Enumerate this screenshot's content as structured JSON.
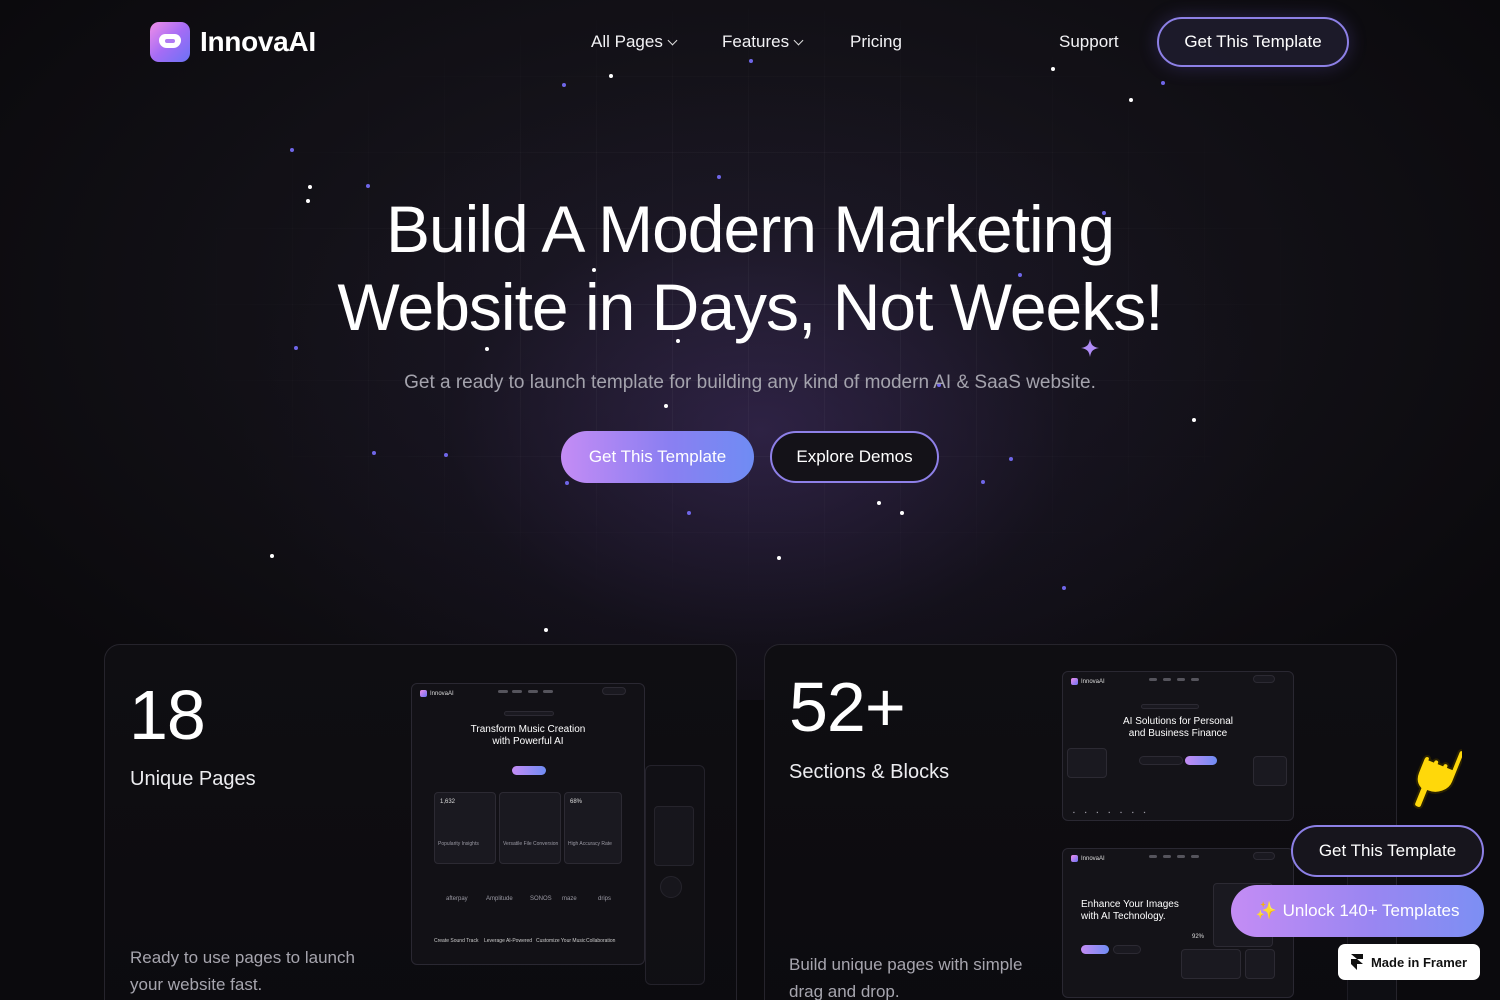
{
  "brand": {
    "name": "InnovaAI"
  },
  "nav": {
    "items": [
      {
        "label": "All Pages",
        "dropdown": true
      },
      {
        "label": "Features",
        "dropdown": true
      },
      {
        "label": "Pricing",
        "dropdown": false
      }
    ],
    "support_label": "Support",
    "cta_label": "Get This Template"
  },
  "hero": {
    "title_line1": "Build A Modern Marketing",
    "title_line2": "Website in Days, Not Weeks!",
    "subtitle": "Get a ready to launch template for building any kind of modern AI & SaaS website.",
    "primary_cta": "Get This Template",
    "secondary_cta": "Explore Demos"
  },
  "stats": [
    {
      "number": "18",
      "label": "Unique Pages",
      "description": "Ready to use pages to launch your website fast."
    },
    {
      "number": "52+",
      "label": "Sections & Blocks",
      "description": "Build unique pages with simple drag and drop."
    }
  ],
  "previews": {
    "music": {
      "brand": "InnovaAI",
      "title_line1": "Transform Music Creation",
      "title_line2": "with Powerful AI",
      "stat1": "1,632",
      "stat2": "68%",
      "feature1": "Popularity Insights",
      "feature2": "Versatile File Conversion",
      "feature3": "High Accuracy Rate",
      "logos": [
        "afterpay",
        "Amplitude",
        "SONOS",
        "maze",
        "drips"
      ],
      "bottom": [
        "Create Sound Track",
        "Leverage AI-Powered",
        "Customize Your Music",
        "Collaboration"
      ]
    },
    "finance": {
      "brand": "InnovaAI",
      "title_line1": "AI Solutions for Personal",
      "title_line2": "and Business Finance"
    },
    "image": {
      "brand": "InnovaAI",
      "title_line1": "Enhance Your Images",
      "title_line2": "with AI Technology.",
      "stat": "92%"
    }
  },
  "floating": {
    "cta_label": "Get This Template",
    "unlock_label": "Unlock 140+ Templates",
    "unlock_icon": "sparkles-icon",
    "made_in_label": "Made in Framer"
  },
  "colors": {
    "background": "#0b0a0d",
    "accent_purple": "#8d80e6",
    "gradient_start": "#c48cf4",
    "gradient_end": "#6f8cf3",
    "star_blue": "#6f66e8"
  }
}
